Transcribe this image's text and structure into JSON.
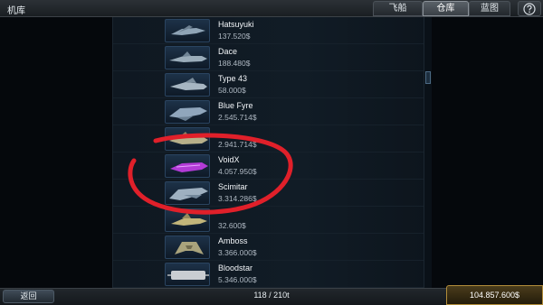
{
  "header": {
    "title": "机库",
    "tabs": [
      {
        "label": "飞船",
        "active": false
      },
      {
        "label": "仓库",
        "active": true
      },
      {
        "label": "蓝图",
        "active": false
      }
    ],
    "help_icon": "help-icon"
  },
  "ships": [
    {
      "name": "Hatsuyuki",
      "price": "137.520$"
    },
    {
      "name": "Dace",
      "price": "188.480$"
    },
    {
      "name": "Type 43",
      "price": "58.000$"
    },
    {
      "name": "Blue Fyre",
      "price": "2.545.714$"
    },
    {
      "name": "",
      "price": "2.941.714$"
    },
    {
      "name": "VoidX",
      "price": "4.057.950$"
    },
    {
      "name": "Scimitar",
      "price": "3.314.286$"
    },
    {
      "name": "",
      "price": "32.600$"
    },
    {
      "name": "Amboss",
      "price": "3.366.000$"
    },
    {
      "name": "Bloodstar",
      "price": "5.346.000$"
    }
  ],
  "footer": {
    "back_label": "返回",
    "capacity": "118 / 210t",
    "credits": "104.857.600$"
  },
  "colors": {
    "annotation_stroke": "#e0202a",
    "credits_border": "#b28d3a",
    "voidx_accent": "#b23bd6"
  }
}
